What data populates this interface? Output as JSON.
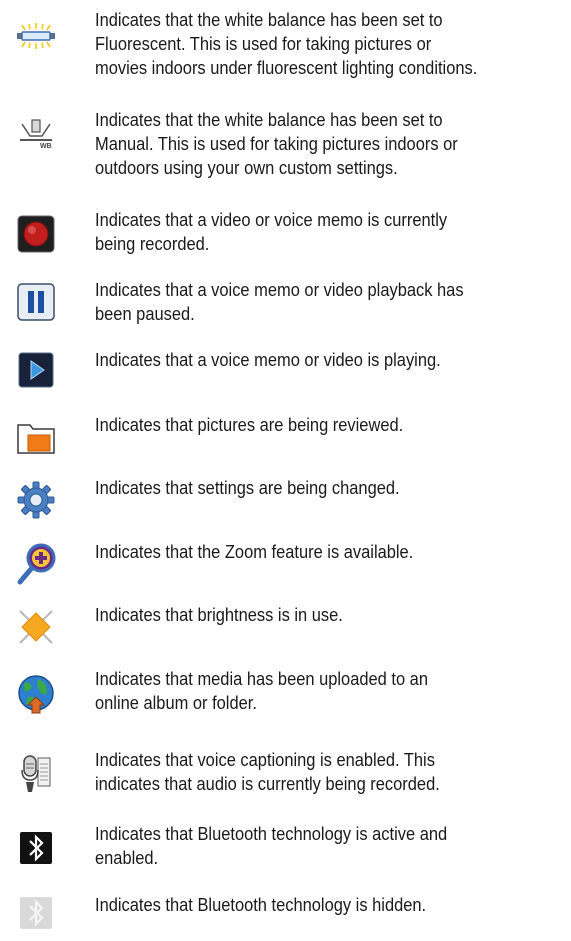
{
  "items": [
    {
      "icon": "fluorescent-white-balance-icon",
      "lines": [
        "Indicates that the white balance has been set to",
        "Fluorescent. This is used for taking pictures or",
        "movies indoors under fluorescent lighting conditions."
      ]
    },
    {
      "icon": "manual-white-balance-icon",
      "lines": [
        "Indicates that the white balance has been set to",
        "Manual. This is used for taking pictures indoors or",
        "outdoors using your own custom settings."
      ]
    },
    {
      "icon": "record-icon",
      "lines": [
        "Indicates that a video or voice memo is currently",
        "being recorded."
      ]
    },
    {
      "icon": "pause-icon",
      "lines": [
        "Indicates that a voice memo or video playback has",
        "been paused."
      ]
    },
    {
      "icon": "play-icon",
      "lines": [
        "Indicates that a voice memo or video is playing."
      ]
    },
    {
      "icon": "folder-icon",
      "lines": [
        "Indicates that pictures are being reviewed."
      ]
    },
    {
      "icon": "settings-gear-icon",
      "lines": [
        "Indicates that settings are being changed."
      ]
    },
    {
      "icon": "zoom-icon",
      "lines": [
        "Indicates that the Zoom feature is available."
      ]
    },
    {
      "icon": "brightness-icon",
      "lines": [
        "Indicates that brightness is in use."
      ]
    },
    {
      "icon": "online-upload-globe-icon",
      "lines": [
        "Indicates that media has been uploaded to an",
        "online album or folder."
      ]
    },
    {
      "icon": "voice-captioning-icon",
      "lines": [
        "Indicates that voice captioning is enabled. This",
        "indicates that audio is currently being recorded."
      ]
    },
    {
      "icon": "bluetooth-active-icon",
      "lines": [
        "Indicates that Bluetooth technology is active and",
        "enabled."
      ]
    },
    {
      "icon": "bluetooth-hidden-icon",
      "lines": [
        "Indicates that Bluetooth technology is hidden."
      ]
    }
  ]
}
